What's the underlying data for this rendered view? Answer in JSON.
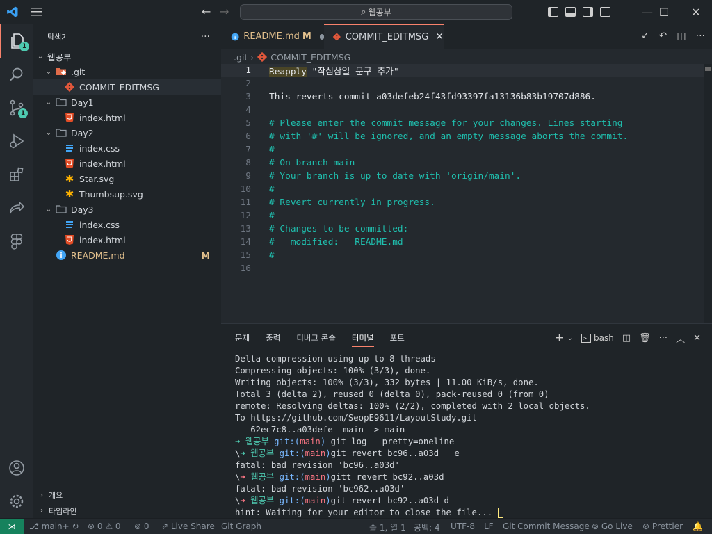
{
  "titlebar": {
    "search_text": "웹공부"
  },
  "activity_bar": {
    "explorer_badge": "1",
    "scm_badge": "1"
  },
  "sidebar": {
    "title": "탐색기",
    "root": "웹공부",
    "items": [
      {
        "label": ".git",
        "type": "folder-git",
        "depth": 1
      },
      {
        "label": "COMMIT_EDITMSG",
        "type": "git-file",
        "depth": 2
      },
      {
        "label": "Day1",
        "type": "folder",
        "depth": 1
      },
      {
        "label": "index.html",
        "type": "html",
        "depth": 2
      },
      {
        "label": "Day2",
        "type": "folder",
        "depth": 1
      },
      {
        "label": "index.css",
        "type": "css",
        "depth": 2
      },
      {
        "label": "index.html",
        "type": "html",
        "depth": 2
      },
      {
        "label": "Star.svg",
        "type": "svg",
        "depth": 2
      },
      {
        "label": "Thumbsup.svg",
        "type": "svg",
        "depth": 2
      },
      {
        "label": "Day3",
        "type": "folder",
        "depth": 1
      },
      {
        "label": "index.css",
        "type": "css",
        "depth": 2
      },
      {
        "label": "index.html",
        "type": "html",
        "depth": 2
      },
      {
        "label": "README.md",
        "type": "info",
        "depth": 1,
        "badge": "M"
      }
    ],
    "outline": "개요",
    "timeline": "타임라인"
  },
  "tabs": [
    {
      "label": "README.md",
      "badge": "M"
    },
    {
      "label": "COMMIT_EDITMSG"
    }
  ],
  "breadcrumb": {
    "part1": ".git",
    "part2": "COMMIT_EDITMSG"
  },
  "code": {
    "l1_a": "Reapply",
    "l1_b": " \"작심삼일 문구 추가\"",
    "lines": [
      "",
      "",
      "This reverts commit a03defeb24f43fd93397fa13136b83b19707d886.",
      "",
      "# Please enter the commit message for your changes. Lines starting",
      "# with '#' will be ignored, and an empty message aborts the commit.",
      "#",
      "# On branch main",
      "# Your branch is up to date with 'origin/main'.",
      "#",
      "# Revert currently in progress.",
      "#",
      "# Changes to be committed:",
      "#   modified:   README.md",
      "#",
      ""
    ],
    "numbers": [
      "1",
      "2",
      "3",
      "4",
      "5",
      "6",
      "7",
      "8",
      "9",
      "10",
      "11",
      "12",
      "13",
      "14",
      "15",
      "16"
    ]
  },
  "panel": {
    "tabs": [
      "문제",
      "출력",
      "디버그 콘솔",
      "터미널",
      "포트"
    ],
    "shell": "bash"
  },
  "terminal": {
    "plain": [
      "Delta compression using up to 8 threads",
      "Compressing objects: 100% (3/3), done.",
      "Writing objects: 100% (3/3), 332 bytes | 11.00 KiB/s, done.",
      "Total 3 (delta 2), reused 0 (delta 0), pack-reused 0 (from 0)",
      "remote: Resolving deltas: 100% (2/2), completed with 2 local objects.",
      "To https://github.com/SeopE9611/LayoutStudy.git",
      "   62ec7c8..a03defe  main -> main"
    ],
    "p1": {
      "arrow": "➜",
      "dir": "웹공부",
      "git": "git:(",
      "branch": "main",
      "close": ")",
      "cmd": " git log --pretty=oneline"
    },
    "p2": {
      "prefix": "\\",
      "arrow": "➜",
      "dir": "웹공부",
      "git": "git:(",
      "branch": "main",
      "close": ")",
      "cmd": "git revert bc96..a03d   e"
    },
    "err1": "fatal: bad revision 'bc96..a03d'",
    "p3": {
      "prefix": "\\",
      "arrow": "➜",
      "dir": "웹공부",
      "git": "git:(",
      "branch": "main",
      "close": ")",
      "cmd": "gitt revert bc92..a03d"
    },
    "err2": "fatal: bad revision 'bc962..a03d'",
    "p4": {
      "prefix": "\\",
      "arrow": "➜",
      "dir": "웹공부",
      "git": "git:(",
      "branch": "main",
      "close": ")",
      "cmd": "git revert bc92..a03d d"
    },
    "hint": "hint: Waiting for your editor to close the file... "
  },
  "statusbar": {
    "branch": "main+",
    "errors": "0",
    "warnings": "0",
    "ports": "0",
    "live_share": "Live Share",
    "git_graph": "Git Graph",
    "position": "줄 1, 열 1",
    "spaces": "공백: 4",
    "encoding": "UTF-8",
    "eol": "LF",
    "language": "Git Commit Message",
    "go_live": "Go Live",
    "prettier": "Prettier"
  }
}
